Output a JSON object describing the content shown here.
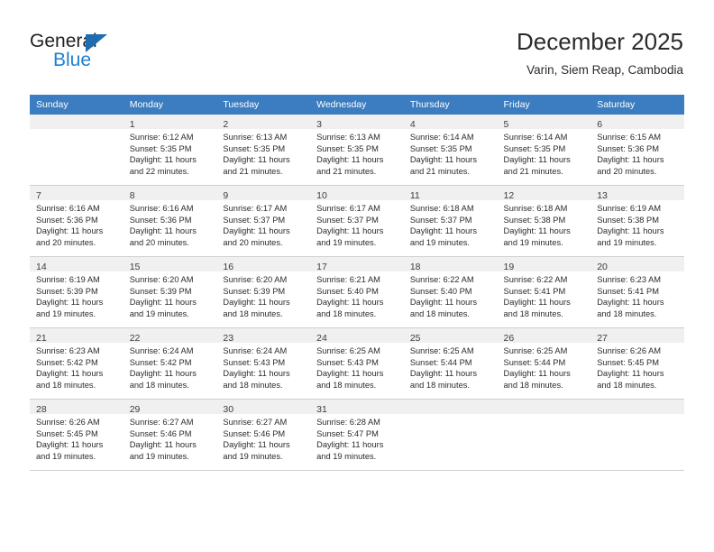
{
  "brand": {
    "name_part1": "General",
    "name_part2": "Blue",
    "logo_icon": "triangle-flag-icon",
    "color_dark": "#231f20",
    "color_blue": "#1c7fd4",
    "color_triangle": "#1f6cb0"
  },
  "header": {
    "title": "December 2025",
    "subtitle": "Varin, Siem Reap, Cambodia"
  },
  "theme": {
    "header_row_bg": "#3b7dc0",
    "header_row_text": "#ffffff",
    "day_number_bg": "#f0f0f0",
    "grid_line": "#cfcfcf"
  },
  "calendar": {
    "weekday_headers": [
      "Sunday",
      "Monday",
      "Tuesday",
      "Wednesday",
      "Thursday",
      "Friday",
      "Saturday"
    ],
    "weeks": [
      [
        {
          "day": "",
          "sunrise": "",
          "sunset": "",
          "daylight_line1": "",
          "daylight_line2": ""
        },
        {
          "day": "1",
          "sunrise": "Sunrise: 6:12 AM",
          "sunset": "Sunset: 5:35 PM",
          "daylight_line1": "Daylight: 11 hours",
          "daylight_line2": "and 22 minutes."
        },
        {
          "day": "2",
          "sunrise": "Sunrise: 6:13 AM",
          "sunset": "Sunset: 5:35 PM",
          "daylight_line1": "Daylight: 11 hours",
          "daylight_line2": "and 21 minutes."
        },
        {
          "day": "3",
          "sunrise": "Sunrise: 6:13 AM",
          "sunset": "Sunset: 5:35 PM",
          "daylight_line1": "Daylight: 11 hours",
          "daylight_line2": "and 21 minutes."
        },
        {
          "day": "4",
          "sunrise": "Sunrise: 6:14 AM",
          "sunset": "Sunset: 5:35 PM",
          "daylight_line1": "Daylight: 11 hours",
          "daylight_line2": "and 21 minutes."
        },
        {
          "day": "5",
          "sunrise": "Sunrise: 6:14 AM",
          "sunset": "Sunset: 5:35 PM",
          "daylight_line1": "Daylight: 11 hours",
          "daylight_line2": "and 21 minutes."
        },
        {
          "day": "6",
          "sunrise": "Sunrise: 6:15 AM",
          "sunset": "Sunset: 5:36 PM",
          "daylight_line1": "Daylight: 11 hours",
          "daylight_line2": "and 20 minutes."
        }
      ],
      [
        {
          "day": "7",
          "sunrise": "Sunrise: 6:16 AM",
          "sunset": "Sunset: 5:36 PM",
          "daylight_line1": "Daylight: 11 hours",
          "daylight_line2": "and 20 minutes."
        },
        {
          "day": "8",
          "sunrise": "Sunrise: 6:16 AM",
          "sunset": "Sunset: 5:36 PM",
          "daylight_line1": "Daylight: 11 hours",
          "daylight_line2": "and 20 minutes."
        },
        {
          "day": "9",
          "sunrise": "Sunrise: 6:17 AM",
          "sunset": "Sunset: 5:37 PM",
          "daylight_line1": "Daylight: 11 hours",
          "daylight_line2": "and 20 minutes."
        },
        {
          "day": "10",
          "sunrise": "Sunrise: 6:17 AM",
          "sunset": "Sunset: 5:37 PM",
          "daylight_line1": "Daylight: 11 hours",
          "daylight_line2": "and 19 minutes."
        },
        {
          "day": "11",
          "sunrise": "Sunrise: 6:18 AM",
          "sunset": "Sunset: 5:37 PM",
          "daylight_line1": "Daylight: 11 hours",
          "daylight_line2": "and 19 minutes."
        },
        {
          "day": "12",
          "sunrise": "Sunrise: 6:18 AM",
          "sunset": "Sunset: 5:38 PM",
          "daylight_line1": "Daylight: 11 hours",
          "daylight_line2": "and 19 minutes."
        },
        {
          "day": "13",
          "sunrise": "Sunrise: 6:19 AM",
          "sunset": "Sunset: 5:38 PM",
          "daylight_line1": "Daylight: 11 hours",
          "daylight_line2": "and 19 minutes."
        }
      ],
      [
        {
          "day": "14",
          "sunrise": "Sunrise: 6:19 AM",
          "sunset": "Sunset: 5:39 PM",
          "daylight_line1": "Daylight: 11 hours",
          "daylight_line2": "and 19 minutes."
        },
        {
          "day": "15",
          "sunrise": "Sunrise: 6:20 AM",
          "sunset": "Sunset: 5:39 PM",
          "daylight_line1": "Daylight: 11 hours",
          "daylight_line2": "and 19 minutes."
        },
        {
          "day": "16",
          "sunrise": "Sunrise: 6:20 AM",
          "sunset": "Sunset: 5:39 PM",
          "daylight_line1": "Daylight: 11 hours",
          "daylight_line2": "and 18 minutes."
        },
        {
          "day": "17",
          "sunrise": "Sunrise: 6:21 AM",
          "sunset": "Sunset: 5:40 PM",
          "daylight_line1": "Daylight: 11 hours",
          "daylight_line2": "and 18 minutes."
        },
        {
          "day": "18",
          "sunrise": "Sunrise: 6:22 AM",
          "sunset": "Sunset: 5:40 PM",
          "daylight_line1": "Daylight: 11 hours",
          "daylight_line2": "and 18 minutes."
        },
        {
          "day": "19",
          "sunrise": "Sunrise: 6:22 AM",
          "sunset": "Sunset: 5:41 PM",
          "daylight_line1": "Daylight: 11 hours",
          "daylight_line2": "and 18 minutes."
        },
        {
          "day": "20",
          "sunrise": "Sunrise: 6:23 AM",
          "sunset": "Sunset: 5:41 PM",
          "daylight_line1": "Daylight: 11 hours",
          "daylight_line2": "and 18 minutes."
        }
      ],
      [
        {
          "day": "21",
          "sunrise": "Sunrise: 6:23 AM",
          "sunset": "Sunset: 5:42 PM",
          "daylight_line1": "Daylight: 11 hours",
          "daylight_line2": "and 18 minutes."
        },
        {
          "day": "22",
          "sunrise": "Sunrise: 6:24 AM",
          "sunset": "Sunset: 5:42 PM",
          "daylight_line1": "Daylight: 11 hours",
          "daylight_line2": "and 18 minutes."
        },
        {
          "day": "23",
          "sunrise": "Sunrise: 6:24 AM",
          "sunset": "Sunset: 5:43 PM",
          "daylight_line1": "Daylight: 11 hours",
          "daylight_line2": "and 18 minutes."
        },
        {
          "day": "24",
          "sunrise": "Sunrise: 6:25 AM",
          "sunset": "Sunset: 5:43 PM",
          "daylight_line1": "Daylight: 11 hours",
          "daylight_line2": "and 18 minutes."
        },
        {
          "day": "25",
          "sunrise": "Sunrise: 6:25 AM",
          "sunset": "Sunset: 5:44 PM",
          "daylight_line1": "Daylight: 11 hours",
          "daylight_line2": "and 18 minutes."
        },
        {
          "day": "26",
          "sunrise": "Sunrise: 6:25 AM",
          "sunset": "Sunset: 5:44 PM",
          "daylight_line1": "Daylight: 11 hours",
          "daylight_line2": "and 18 minutes."
        },
        {
          "day": "27",
          "sunrise": "Sunrise: 6:26 AM",
          "sunset": "Sunset: 5:45 PM",
          "daylight_line1": "Daylight: 11 hours",
          "daylight_line2": "and 18 minutes."
        }
      ],
      [
        {
          "day": "28",
          "sunrise": "Sunrise: 6:26 AM",
          "sunset": "Sunset: 5:45 PM",
          "daylight_line1": "Daylight: 11 hours",
          "daylight_line2": "and 19 minutes."
        },
        {
          "day": "29",
          "sunrise": "Sunrise: 6:27 AM",
          "sunset": "Sunset: 5:46 PM",
          "daylight_line1": "Daylight: 11 hours",
          "daylight_line2": "and 19 minutes."
        },
        {
          "day": "30",
          "sunrise": "Sunrise: 6:27 AM",
          "sunset": "Sunset: 5:46 PM",
          "daylight_line1": "Daylight: 11 hours",
          "daylight_line2": "and 19 minutes."
        },
        {
          "day": "31",
          "sunrise": "Sunrise: 6:28 AM",
          "sunset": "Sunset: 5:47 PM",
          "daylight_line1": "Daylight: 11 hours",
          "daylight_line2": "and 19 minutes."
        },
        {
          "day": "",
          "sunrise": "",
          "sunset": "",
          "daylight_line1": "",
          "daylight_line2": ""
        },
        {
          "day": "",
          "sunrise": "",
          "sunset": "",
          "daylight_line1": "",
          "daylight_line2": ""
        },
        {
          "day": "",
          "sunrise": "",
          "sunset": "",
          "daylight_line1": "",
          "daylight_line2": ""
        }
      ]
    ]
  }
}
